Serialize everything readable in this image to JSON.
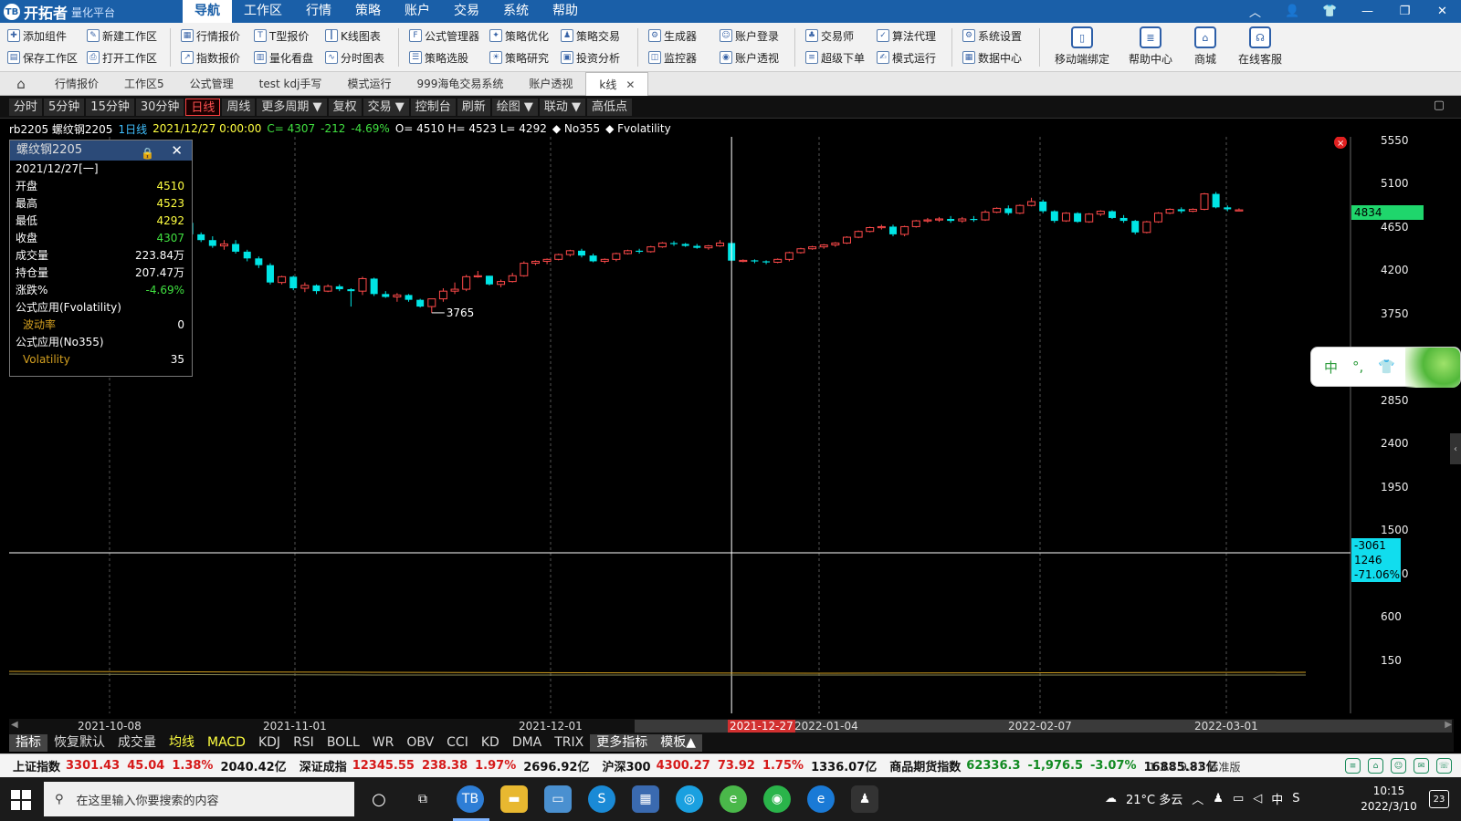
{
  "app": {
    "logo_icon": "TB",
    "name": "开拓者",
    "subtitle": "量化平台",
    "menu": [
      "导航",
      "工作区",
      "行情",
      "策略",
      "账户",
      "交易",
      "系统",
      "帮助"
    ],
    "window_controls": [
      "︿",
      "👤",
      "👕",
      "—",
      "❐",
      "✕"
    ]
  },
  "toolbar": {
    "col1": [
      "添加组件",
      "保存工作区"
    ],
    "col2": [
      "新建工作区",
      "打开工作区"
    ],
    "col3": [
      "行情报价",
      "指数报价"
    ],
    "col4": [
      "T型报价",
      "量化看盘"
    ],
    "col5": [
      "K线图表",
      "分时图表"
    ],
    "col6": [
      "公式管理器",
      "策略选股"
    ],
    "col7": [
      "策略优化",
      "策略研究"
    ],
    "col8": [
      "策略交易",
      "投资分析"
    ],
    "col9": [
      "生成器",
      "监控器"
    ],
    "col10": [
      "账户登录",
      "账户透视"
    ],
    "col11": [
      "交易师",
      "超级下单"
    ],
    "col12": [
      "算法代理",
      "模式运行"
    ],
    "col13": [
      "系统设置",
      "数据中心"
    ],
    "big": [
      "移动端绑定",
      "帮助中心",
      "商城",
      "在线客服"
    ]
  },
  "tabs": {
    "home_icon": "⌂",
    "items": [
      "行情报价",
      "工作区5",
      "公式管理",
      "test kdj手写",
      "模式运行",
      "999海龟交易系统",
      "账户透视",
      "k线"
    ],
    "active": "k线",
    "close": "✕"
  },
  "periods": {
    "items": [
      "分时",
      "5分钟",
      "15分钟",
      "30分钟",
      "日线",
      "周线",
      "更多周期 ▼",
      "复权",
      "交易 ▼",
      "控制台",
      "刷新",
      "绘图 ▼",
      "联动 ▼",
      "高低点"
    ],
    "active": "日线",
    "right_icon": "▢"
  },
  "infoline": {
    "symbol": "rb2205 螺纹钢2205",
    "period": "1日线",
    "datetime": "2021/12/27 0:00:00",
    "close": "C= 4307",
    "change": "-212",
    "change_pct": "-4.69%",
    "ohl": "O= 4510 H= 4523 L= 4292",
    "formula1": "◆ No355",
    "formula2": "◆ Fvolatility"
  },
  "popup": {
    "title": "螺纹钢2205",
    "date": "2021/12/27[一]",
    "rows": [
      {
        "k": "开盘",
        "v": "4510"
      },
      {
        "k": "最高",
        "v": "4523"
      },
      {
        "k": "最低",
        "v": "4292"
      },
      {
        "k": "收盘",
        "v": "4307"
      },
      {
        "k": "成交量",
        "v": "223.84万"
      },
      {
        "k": "持仓量",
        "v": "207.47万"
      },
      {
        "k": "涨跌%",
        "v": "-4.69%"
      }
    ],
    "formula1": "公式应用(Fvolatility)",
    "sub1_k": "波动率",
    "sub1_v": "0",
    "formula2": "公式应用(No355)",
    "sub2_k": "Volatility",
    "sub2_v": "35"
  },
  "chart_data": {
    "type": "candlestick",
    "yticks": [
      5550,
      5100,
      4650,
      4200,
      3750,
      2850,
      2400,
      1950,
      1500,
      1050,
      600,
      150
    ],
    "ylim": [
      0,
      5800
    ],
    "last_price": "4834",
    "low_mark": "3765",
    "cursor_box": [
      "-3061",
      "1246",
      "-71.06%"
    ],
    "x_dates": [
      "2021-10-08",
      "2021-11-01",
      "2021-12-01",
      "2021-12-27",
      "2022-01-04",
      "2022-02-07",
      "2022-03-01"
    ],
    "candles": [
      [
        4880,
        4960,
        4840,
        4920
      ],
      [
        4920,
        5040,
        4900,
        5010
      ],
      [
        5010,
        5100,
        4980,
        5060
      ],
      [
        5060,
        5120,
        5000,
        5100
      ],
      [
        5100,
        5180,
        5050,
        5140
      ],
      [
        5140,
        5220,
        5080,
        5180
      ],
      [
        5180,
        5250,
        5120,
        5150
      ],
      [
        5150,
        5200,
        5020,
        5050
      ],
      [
        5050,
        5120,
        5000,
        5080
      ],
      [
        5080,
        5120,
        5030,
        5060
      ],
      [
        5060,
        5080,
        4940,
        4960
      ],
      [
        4960,
        5000,
        4680,
        4700
      ],
      [
        4700,
        4720,
        4550,
        4580
      ],
      [
        4580,
        4600,
        4500,
        4520
      ],
      [
        4520,
        4560,
        4440,
        4460
      ],
      [
        4460,
        4520,
        4420,
        4480
      ],
      [
        4480,
        4520,
        4380,
        4400
      ],
      [
        4400,
        4420,
        4300,
        4330
      ],
      [
        4330,
        4350,
        4230,
        4260
      ],
      [
        4260,
        4280,
        4060,
        4080
      ],
      [
        4080,
        4150,
        4060,
        4140
      ],
      [
        4140,
        4150,
        4000,
        4020
      ],
      [
        4020,
        4080,
        3980,
        4050
      ],
      [
        4050,
        4060,
        3960,
        3990
      ],
      [
        3990,
        4060,
        3980,
        4040
      ],
      [
        4040,
        4060,
        3990,
        4010
      ],
      [
        4010,
        4020,
        3830,
        3990
      ],
      [
        3990,
        4140,
        3950,
        4120
      ],
      [
        4120,
        4130,
        3940,
        3960
      ],
      [
        3960,
        3990,
        3920,
        3930
      ],
      [
        3930,
        3970,
        3880,
        3950
      ],
      [
        3950,
        3960,
        3880,
        3900
      ],
      [
        3900,
        3910,
        3820,
        3830
      ],
      [
        3830,
        3910,
        3765,
        3910
      ],
      [
        3910,
        4020,
        3880,
        3990
      ],
      [
        3990,
        4080,
        3960,
        4010
      ],
      [
        4010,
        4160,
        3990,
        4140
      ],
      [
        4140,
        4200,
        4130,
        4150
      ],
      [
        4150,
        4150,
        4050,
        4060
      ],
      [
        4060,
        4110,
        4030,
        4090
      ],
      [
        4090,
        4180,
        4080,
        4150
      ],
      [
        4150,
        4300,
        4140,
        4280
      ],
      [
        4280,
        4310,
        4260,
        4300
      ],
      [
        4300,
        4330,
        4270,
        4320
      ],
      [
        4320,
        4380,
        4310,
        4370
      ],
      [
        4370,
        4420,
        4350,
        4410
      ],
      [
        4410,
        4430,
        4340,
        4360
      ],
      [
        4360,
        4380,
        4290,
        4300
      ],
      [
        4300,
        4330,
        4280,
        4320
      ],
      [
        4320,
        4390,
        4300,
        4380
      ],
      [
        4380,
        4420,
        4370,
        4410
      ],
      [
        4410,
        4430,
        4380,
        4400
      ],
      [
        4400,
        4460,
        4390,
        4450
      ],
      [
        4450,
        4500,
        4440,
        4490
      ],
      [
        4490,
        4510,
        4460,
        4480
      ],
      [
        4480,
        4490,
        4450,
        4460
      ],
      [
        4460,
        4480,
        4430,
        4440
      ],
      [
        4440,
        4470,
        4420,
        4460
      ],
      [
        4460,
        4520,
        4450,
        4490
      ],
      [
        4490,
        4510,
        4300,
        4307
      ],
      [
        4307,
        4320,
        4290,
        4310
      ],
      [
        4310,
        4320,
        4280,
        4300
      ],
      [
        4300,
        4310,
        4270,
        4290
      ],
      [
        4290,
        4330,
        4280,
        4320
      ],
      [
        4320,
        4400,
        4300,
        4390
      ],
      [
        4390,
        4440,
        4380,
        4430
      ],
      [
        4430,
        4460,
        4420,
        4450
      ],
      [
        4450,
        4480,
        4430,
        4470
      ],
      [
        4470,
        4500,
        4450,
        4490
      ],
      [
        4490,
        4560,
        4480,
        4550
      ],
      [
        4550,
        4620,
        4540,
        4610
      ],
      [
        4610,
        4660,
        4600,
        4650
      ],
      [
        4650,
        4680,
        4630,
        4660
      ],
      [
        4660,
        4680,
        4560,
        4580
      ],
      [
        4580,
        4670,
        4560,
        4660
      ],
      [
        4660,
        4730,
        4650,
        4720
      ],
      [
        4720,
        4750,
        4700,
        4730
      ],
      [
        4730,
        4760,
        4710,
        4740
      ],
      [
        4740,
        4770,
        4700,
        4720
      ],
      [
        4720,
        4760,
        4700,
        4740
      ],
      [
        4740,
        4770,
        4710,
        4730
      ],
      [
        4730,
        4830,
        4720,
        4810
      ],
      [
        4810,
        4860,
        4800,
        4850
      ],
      [
        4850,
        4880,
        4780,
        4800
      ],
      [
        4800,
        4890,
        4790,
        4880
      ],
      [
        4880,
        4960,
        4870,
        4920
      ],
      [
        4920,
        4940,
        4800,
        4820
      ],
      [
        4820,
        4830,
        4700,
        4720
      ],
      [
        4720,
        4810,
        4710,
        4800
      ],
      [
        4800,
        4810,
        4700,
        4710
      ],
      [
        4710,
        4800,
        4700,
        4790
      ],
      [
        4790,
        4830,
        4770,
        4820
      ],
      [
        4820,
        4830,
        4740,
        4750
      ],
      [
        4750,
        4780,
        4700,
        4720
      ],
      [
        4720,
        4730,
        4580,
        4600
      ],
      [
        4600,
        4720,
        4590,
        4710
      ],
      [
        4710,
        4810,
        4700,
        4800
      ],
      [
        4800,
        4850,
        4790,
        4840
      ],
      [
        4840,
        4860,
        4800,
        4820
      ],
      [
        4820,
        4850,
        4810,
        4840
      ],
      [
        4840,
        5010,
        4830,
        5000
      ],
      [
        5000,
        5020,
        4850,
        4860
      ],
      [
        4860,
        4880,
        4820,
        4840
      ],
      [
        4834,
        4850,
        4820,
        4834
      ]
    ]
  },
  "indicators": {
    "items": [
      "指标",
      "恢复默认",
      "成交量",
      "均线",
      "MACD",
      "KDJ",
      "RSI",
      "BOLL",
      "WR",
      "OBV",
      "CCI",
      "KD",
      "DMA",
      "TRIX",
      "更多指标",
      "模板▲"
    ]
  },
  "status": {
    "sh_name": "上证指数",
    "sh_val": "3301.43",
    "sh_chg": "45.04",
    "sh_pct": "1.38%",
    "sh_amt": "2040.42亿",
    "sz_name": "深证成指",
    "sz_val": "12345.55",
    "sz_chg": "238.38",
    "sz_pct": "1.97%",
    "sz_amt": "2696.92亿",
    "hs_name": "沪深300",
    "hs_val": "4300.27",
    "hs_chg": "73.92",
    "hs_pct": "1.75%",
    "hs_amt": "1336.07亿",
    "cf_name": "商品期货指数",
    "cf_val": "62336.3",
    "cf_chg": "-1,976.5",
    "cf_pct": "-3.07%",
    "cf_amt": "16885.83亿",
    "version": "1.3.4.9.P1 标准版"
  },
  "ime": {
    "lang": "中",
    "punct": "°,",
    "skin": "👕"
  },
  "taskbar": {
    "search_placeholder": "在这里输入你要搜索的内容",
    "weather": "21°C 多云",
    "time": "10:15",
    "date": "2022/3/10",
    "notif": "23"
  }
}
